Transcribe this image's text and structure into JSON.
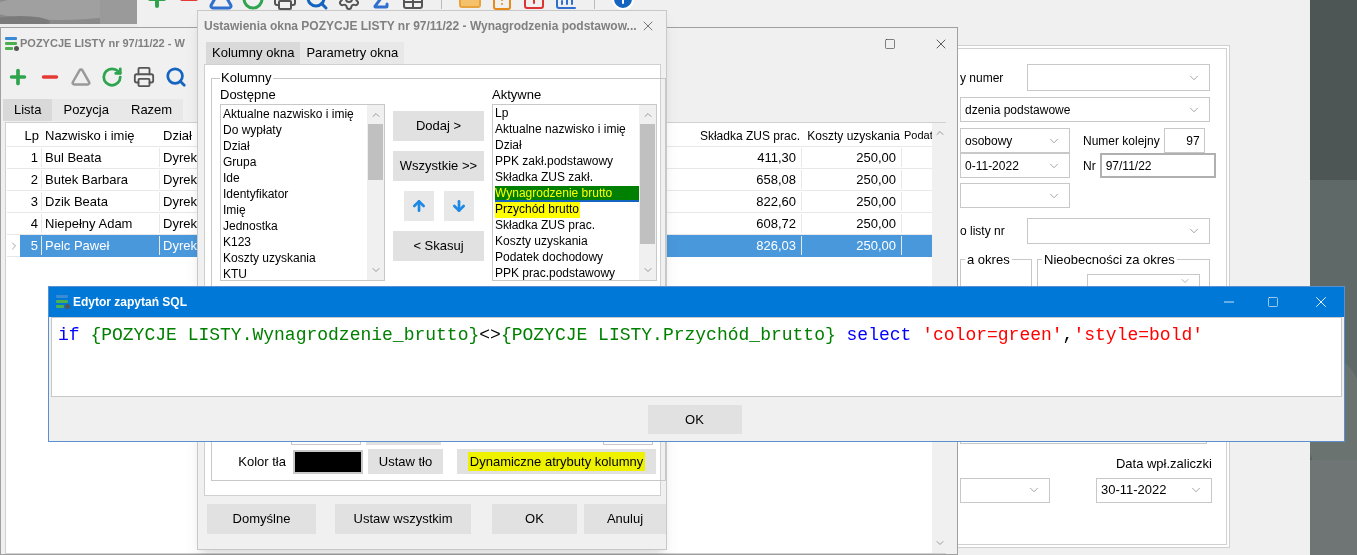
{
  "back_window": {
    "form": {
      "number_label": "y numer",
      "type_combo": "dzenia podstawowe",
      "kind_combo": "osobowy",
      "sequence_label": "Numer kolejny",
      "sequence_value": "97",
      "date_combo": "0-11-2022",
      "nr_label": "Nr",
      "nr_value": "97/11/22",
      "list_label": "o listy nr",
      "period_group": "a okres",
      "absence_group": "Nieobecności za okres",
      "advance_date_label": "Data wpł.zaliczki",
      "advance_date_value": "30-11-2022"
    }
  },
  "list_window": {
    "title": "POZYCJE LISTY nr 97/11/22 - W",
    "tabs": [
      {
        "label": "Lista",
        "selected": true
      },
      {
        "label": "Pozycja",
        "selected": false
      },
      {
        "label": "Razem",
        "selected": false
      }
    ],
    "table": {
      "columns_left": [
        "Lp",
        "Nazwisko i imię",
        "Dział"
      ],
      "columns_right": [
        "Składka ZUS prac.",
        "Koszty uzyskania",
        "Podat"
      ],
      "rows": [
        {
          "lp": "1",
          "name": "Bul Beata",
          "dept": "Dyrek",
          "zus": "411,30",
          "costs": "250,00",
          "selected": false
        },
        {
          "lp": "2",
          "name": "Butek Barbara",
          "dept": "Dyrek",
          "zus": "658,08",
          "costs": "250,00",
          "selected": false
        },
        {
          "lp": "3",
          "name": "Dzik Beata",
          "dept": "Dyrek",
          "zus": "822,60",
          "costs": "250,00",
          "selected": false
        },
        {
          "lp": "4",
          "name": "Niepełny Adam",
          "dept": "Dyrek",
          "zus": "608,72",
          "costs": "250,00",
          "selected": false
        },
        {
          "lp": "5",
          "name": "Pelc Paweł",
          "dept": "Dyrek",
          "zus": "826,03",
          "costs": "250,00",
          "selected": true
        }
      ]
    }
  },
  "settings_dialog": {
    "title": "Ustawienia okna POZYCJE LISTY nr 97/11/22 - Wynagrodzenia podstawow...",
    "tabs": [
      {
        "label": "Kolumny okna",
        "selected": true
      },
      {
        "label": "Parametry okna",
        "selected": false
      }
    ],
    "group_title": "Kolumny",
    "available": {
      "label": "Dostępne",
      "items": [
        "Aktualne nazwisko i imię",
        "Do wypłaty",
        "Dział",
        "Grupa",
        "Ide",
        "Identyfikator",
        "Imię",
        "Jednostka",
        "K123",
        "Koszty uzyskania",
        "KTU"
      ]
    },
    "active": {
      "label": "Aktywne",
      "items": [
        {
          "text": "Lp",
          "selected": false,
          "highlighted": false
        },
        {
          "text": "Aktualne nazwisko i imię",
          "selected": false,
          "highlighted": false
        },
        {
          "text": "Dział",
          "selected": false,
          "highlighted": false
        },
        {
          "text": "PPK zakł.podstawowy",
          "selected": false,
          "highlighted": false
        },
        {
          "text": "Składka ZUS zakł.",
          "selected": false,
          "highlighted": false
        },
        {
          "text": "Wynagrodzenie brutto",
          "selected": true,
          "highlighted": true
        },
        {
          "text": "Przychód brutto",
          "selected": false,
          "highlighted": true
        },
        {
          "text": "Składka ZUS prac.",
          "selected": false,
          "highlighted": false
        },
        {
          "text": "Koszty uzyskania",
          "selected": false,
          "highlighted": false
        },
        {
          "text": "Podatek dochodowy",
          "selected": false,
          "highlighted": false
        },
        {
          "text": "PPK prac.podstawowy",
          "selected": false,
          "highlighted": false
        }
      ]
    },
    "move_buttons": [
      "Dodaj >",
      "Wszystkie >>"
    ],
    "remove_button": "< Skasuj",
    "background_label": "Kolor tła",
    "set_background_button": "Ustaw tło",
    "dynamic_button": {
      "label": "Dynamiczne atrybuty kolumny",
      "highlighted": true
    },
    "footer_buttons": [
      "Domyślne",
      "Ustaw wszystkim",
      "OK",
      "Anuluj"
    ]
  },
  "sql_editor": {
    "title": "Edytor zapytań SQL",
    "code": [
      {
        "kind": "keyword",
        "text": "if"
      },
      {
        "kind": "field",
        "text": " {POZYCJE LISTY.Wynagrodzenie_brutto}"
      },
      {
        "kind": "operator",
        "text": "<>"
      },
      {
        "kind": "field",
        "text": "{POZYCJE LISTY.Przychód_brutto}"
      },
      {
        "kind": "keyword",
        "text": " select"
      },
      {
        "kind": "string",
        "text": " 'color=green'"
      },
      {
        "kind": "operator",
        "text": ","
      },
      {
        "kind": "string",
        "text": "'style=bold'"
      }
    ],
    "button": "OK"
  }
}
